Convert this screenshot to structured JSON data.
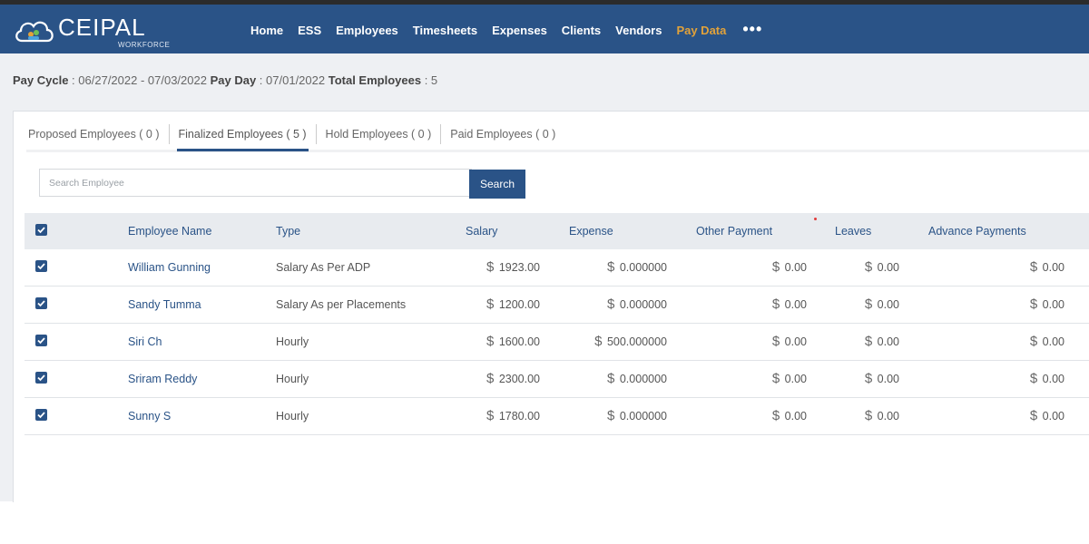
{
  "app": {
    "logo_text": "CEIPAL",
    "logo_sub": "WORKFORCE"
  },
  "nav": {
    "items": [
      {
        "label": "Home",
        "active": false
      },
      {
        "label": "ESS",
        "active": false
      },
      {
        "label": "Employees",
        "active": false
      },
      {
        "label": "Timesheets",
        "active": false
      },
      {
        "label": "Expenses",
        "active": false
      },
      {
        "label": "Clients",
        "active": false
      },
      {
        "label": "Vendors",
        "active": false
      },
      {
        "label": "Pay Data",
        "active": true
      }
    ],
    "more_label": "•••",
    "active_color": "#e2a23a"
  },
  "pay_info": {
    "cycle_label": "Pay Cycle",
    "cycle_value": "06/27/2022 - 07/03/2022",
    "day_label": "Pay Day",
    "day_value": "07/01/2022",
    "total_label": "Total Employees",
    "total_value": "5"
  },
  "tabs": [
    {
      "label": "Proposed Employees ( 0 )",
      "active": false
    },
    {
      "label": "Finalized Employees ( 5 )",
      "active": true
    },
    {
      "label": "Hold Employees ( 0 )",
      "active": false
    },
    {
      "label": "Paid Employees ( 0 )",
      "active": false
    }
  ],
  "search": {
    "placeholder": "Search Employee",
    "value": "",
    "button_label": "Search"
  },
  "table": {
    "headers": {
      "name": "Employee Name",
      "type": "Type",
      "salary": "Salary",
      "expense": "Expense",
      "other": "Other Payment",
      "leaves": "Leaves",
      "advance": "Advance Payments"
    },
    "currency": "$",
    "rows": [
      {
        "name": "William Gunning",
        "type": "Salary As Per ADP",
        "salary": "1923.00",
        "expense": "0.000000",
        "other": "0.00",
        "leaves": "0.00",
        "advance": "0.00",
        "checked": true
      },
      {
        "name": "Sandy Tumma",
        "type": "Salary As per Placements",
        "salary": "1200.00",
        "expense": "0.000000",
        "other": "0.00",
        "leaves": "0.00",
        "advance": "0.00",
        "checked": true
      },
      {
        "name": "Siri Ch",
        "type": "Hourly",
        "salary": "1600.00",
        "expense": "500.000000",
        "other": "0.00",
        "leaves": "0.00",
        "advance": "0.00",
        "checked": true
      },
      {
        "name": "Sriram Reddy",
        "type": "Hourly",
        "salary": "2300.00",
        "expense": "0.000000",
        "other": "0.00",
        "leaves": "0.00",
        "advance": "0.00",
        "checked": true
      },
      {
        "name": "Sunny S",
        "type": "Hourly",
        "salary": "1780.00",
        "expense": "0.000000",
        "other": "0.00",
        "leaves": "0.00",
        "advance": "0.00",
        "checked": true
      }
    ]
  },
  "colors": {
    "brand": "#2a5387",
    "background": "#eef0f3"
  }
}
